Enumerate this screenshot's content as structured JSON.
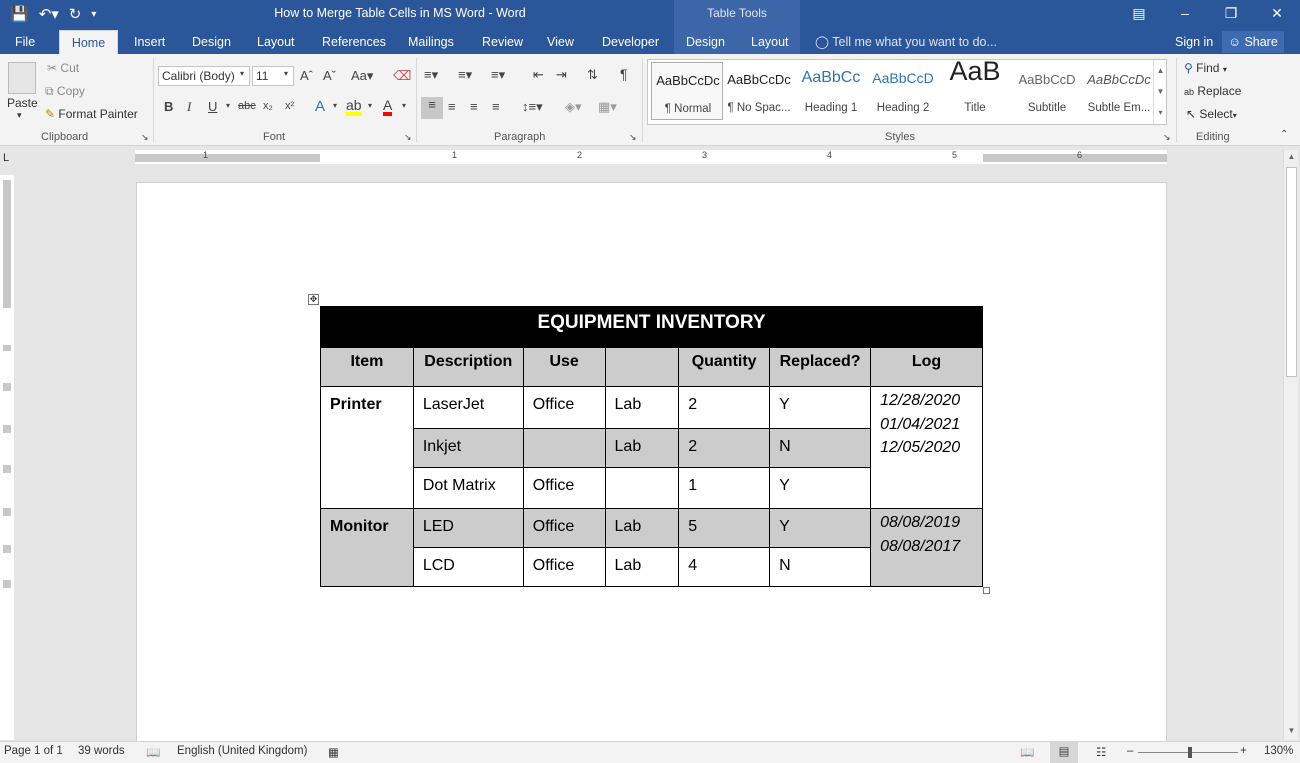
{
  "window": {
    "title": "How to Merge Table Cells in MS Word - Word",
    "context_tab": "Table Tools"
  },
  "tabs": [
    {
      "label": "File"
    },
    {
      "label": "Home"
    },
    {
      "label": "Insert"
    },
    {
      "label": "Design"
    },
    {
      "label": "Layout"
    },
    {
      "label": "References"
    },
    {
      "label": "Mailings"
    },
    {
      "label": "Review"
    },
    {
      "label": "View"
    },
    {
      "label": "Developer"
    },
    {
      "label": "Design"
    },
    {
      "label": "Layout"
    }
  ],
  "tell_me": "Tell me what you want to do...",
  "sign_in": "Sign in",
  "share": "Share",
  "clipboard": {
    "paste": "Paste",
    "cut": "Cut",
    "copy": "Copy",
    "format_painter": "Format Painter",
    "label": "Clipboard"
  },
  "font": {
    "name": "Calibri (Body)",
    "size": "11",
    "label": "Font"
  },
  "paragraph": {
    "label": "Paragraph"
  },
  "styles": {
    "label": "Styles",
    "items": [
      {
        "sample": "AaBbCcDc",
        "name": "¶ Normal"
      },
      {
        "sample": "AaBbCcDc",
        "name": "¶ No Spac..."
      },
      {
        "sample": "AaBbCc",
        "name": "Heading 1"
      },
      {
        "sample": "AaBbCcD",
        "name": "Heading 2"
      },
      {
        "sample": "AaB",
        "name": "Title"
      },
      {
        "sample": "AaBbCcD",
        "name": "Subtitle"
      },
      {
        "sample": "AaBbCcDc",
        "name": "Subtle Em..."
      }
    ]
  },
  "editing": {
    "find": "Find",
    "replace": "Replace",
    "select": "Select",
    "label": "Editing"
  },
  "table": {
    "title": "EQUIPMENT INVENTORY",
    "headers": [
      "Item",
      "Description",
      "Use",
      "",
      "Quantity",
      "Replaced?",
      "Log"
    ],
    "printer": {
      "item": "Printer",
      "rows": [
        {
          "description": "LaserJet",
          "use": "Office",
          "use2": "Lab",
          "quantity": "2",
          "replaced": "Y"
        },
        {
          "description": "Inkjet",
          "use": "",
          "use2": "Lab",
          "quantity": "2",
          "replaced": "N"
        },
        {
          "description": "Dot Matrix",
          "use": "Office",
          "use2": "",
          "quantity": "1",
          "replaced": "Y"
        }
      ],
      "log": [
        "12/28/2020",
        "01/04/2021",
        "12/05/2020"
      ]
    },
    "monitor": {
      "item": "Monitor",
      "rows": [
        {
          "description": "LED",
          "use": "Office",
          "use2": "Lab",
          "quantity": "5",
          "replaced": "Y"
        },
        {
          "description": "LCD",
          "use": "Office",
          "use2": "Lab",
          "quantity": "4",
          "replaced": "N"
        }
      ],
      "log": [
        "08/08/2019",
        "08/08/2017"
      ]
    }
  },
  "ruler_numbers": [
    "1",
    "1",
    "2",
    "3",
    "4",
    "5",
    "6"
  ],
  "status": {
    "page": "Page 1 of 1",
    "words": "39 words",
    "language": "English (United Kingdom)",
    "zoom": "130%"
  }
}
